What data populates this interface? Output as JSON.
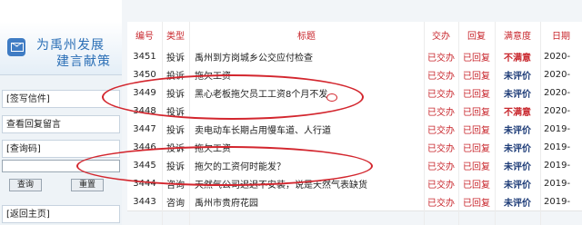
{
  "sidebar": {
    "slogan_line1": "为禹州发展",
    "slogan_line2": "建言献策",
    "nav_sign_letter": "[签写信件]",
    "nav_view_reply": "查看回复留言",
    "nav_query_code": "[查询码]",
    "code_input_value": "",
    "btn_query": "查询",
    "btn_reset": "重置",
    "nav_return_home": "[返回主页]"
  },
  "table": {
    "headers": [
      "编号",
      "类型",
      "标题",
      "交办",
      "回复",
      "满意度",
      "日期"
    ],
    "rows": [
      {
        "id": "3451",
        "type": "投诉",
        "title": "禹州到方岗城乡公交应付检查",
        "submit": "已交办",
        "reply": "已回复",
        "sat": "不满意",
        "date": "2020-"
      },
      {
        "id": "3450",
        "type": "投诉",
        "title": "拖欠工资",
        "submit": "已交办",
        "reply": "已回复",
        "sat": "未评价",
        "date": "2020-"
      },
      {
        "id": "3449",
        "type": "投诉",
        "title": "黑心老板拖欠员工工资8个月不发",
        "submit": "已交办",
        "reply": "已回复",
        "sat": "未评价",
        "date": "2020-"
      },
      {
        "id": "3448",
        "type": "投诉",
        "title": "",
        "submit": "已交办",
        "reply": "已回复",
        "sat": "不满意",
        "date": "2020-"
      },
      {
        "id": "3447",
        "type": "投诉",
        "title": "卖电动车长期占用慢车道、人行道",
        "submit": "已交办",
        "reply": "已回复",
        "sat": "未评价",
        "date": "2019-"
      },
      {
        "id": "3446",
        "type": "投诉",
        "title": "拖欠工资",
        "submit": "已交办",
        "reply": "已回复",
        "sat": "未评价",
        "date": "2019-"
      },
      {
        "id": "3445",
        "type": "投诉",
        "title": "拖欠的工资何时能发？",
        "submit": "已交办",
        "reply": "已回复",
        "sat": "未评价",
        "date": "2019-"
      },
      {
        "id": "3444",
        "type": "咨询",
        "title": "天然气公司迟迟不安装，说是天然气表缺货",
        "submit": "已交办",
        "reply": "已回复",
        "sat": "未评价",
        "date": "2019-"
      },
      {
        "id": "3443",
        "type": "咨询",
        "title": "禹州市贵府花园",
        "submit": "已交办",
        "reply": "已回复",
        "sat": "未评价",
        "date": "2019-"
      }
    ]
  },
  "colors": {
    "accent_red": "#c8262c",
    "brand_blue": "#2b6fb6",
    "annotation_red": "#d3262e"
  },
  "icons": {
    "mail": "mail-icon"
  }
}
